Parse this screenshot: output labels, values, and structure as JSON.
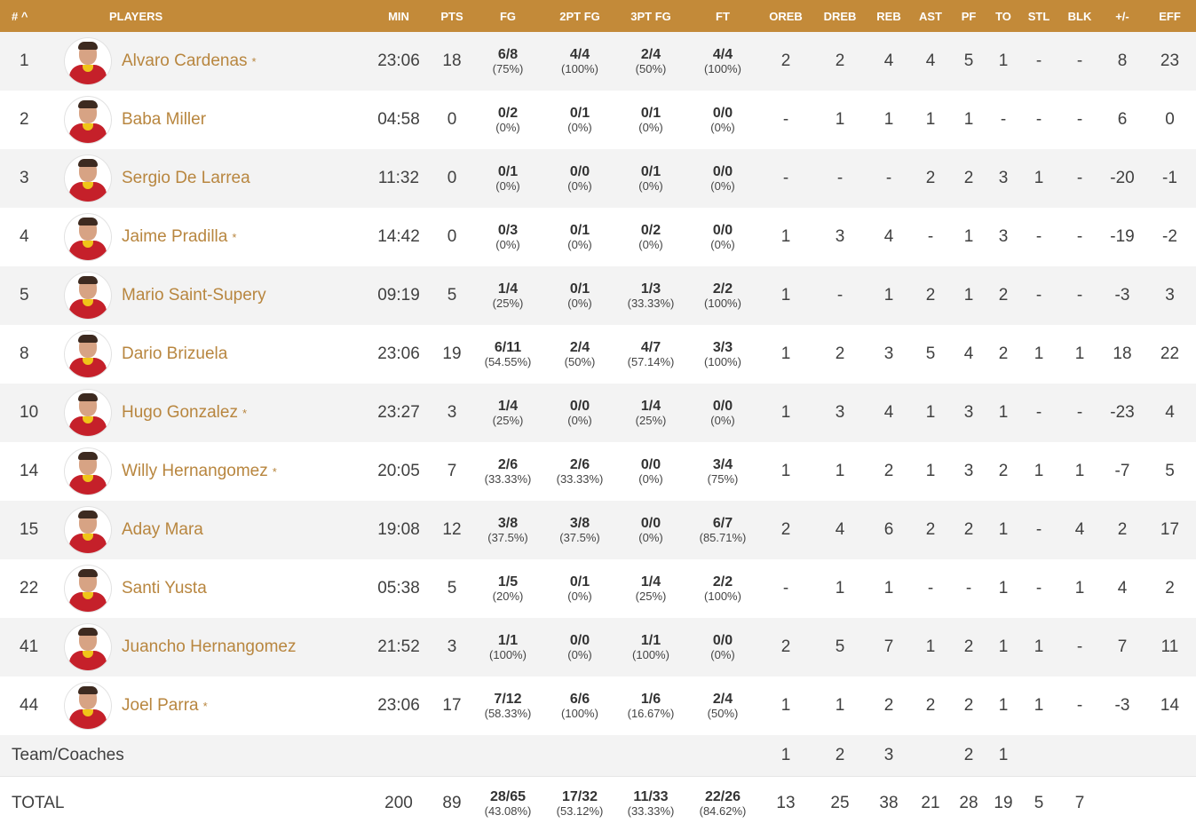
{
  "header": {
    "num": "# ^",
    "players": "PLAYERS",
    "min": "MIN",
    "pts": "PTS",
    "fg": "FG",
    "fg2": "2PT FG",
    "fg3": "3PT FG",
    "ft": "FT",
    "oreb": "OREB",
    "dreb": "DREB",
    "reb": "REB",
    "ast": "AST",
    "pf": "PF",
    "to": "TO",
    "stl": "STL",
    "blk": "BLK",
    "pm": "+/-",
    "eff": "EFF"
  },
  "players": [
    {
      "num": "1",
      "name": "Alvaro Cardenas",
      "starter": "*",
      "min": "23:06",
      "pts": "18",
      "fg": "6/8",
      "fg_pct": "(75%)",
      "fg2": "4/4",
      "fg2_pct": "(100%)",
      "fg3": "2/4",
      "fg3_pct": "(50%)",
      "ft": "4/4",
      "ft_pct": "(100%)",
      "oreb": "2",
      "dreb": "2",
      "reb": "4",
      "ast": "4",
      "pf": "5",
      "to": "1",
      "stl": "-",
      "blk": "-",
      "pm": "8",
      "eff": "23"
    },
    {
      "num": "2",
      "name": "Baba Miller",
      "starter": "",
      "min": "04:58",
      "pts": "0",
      "fg": "0/2",
      "fg_pct": "(0%)",
      "fg2": "0/1",
      "fg2_pct": "(0%)",
      "fg3": "0/1",
      "fg3_pct": "(0%)",
      "ft": "0/0",
      "ft_pct": "(0%)",
      "oreb": "-",
      "dreb": "1",
      "reb": "1",
      "ast": "1",
      "pf": "1",
      "to": "-",
      "stl": "-",
      "blk": "-",
      "pm": "6",
      "eff": "0"
    },
    {
      "num": "3",
      "name": "Sergio De Larrea",
      "starter": "",
      "min": "11:32",
      "pts": "0",
      "fg": "0/1",
      "fg_pct": "(0%)",
      "fg2": "0/0",
      "fg2_pct": "(0%)",
      "fg3": "0/1",
      "fg3_pct": "(0%)",
      "ft": "0/0",
      "ft_pct": "(0%)",
      "oreb": "-",
      "dreb": "-",
      "reb": "-",
      "ast": "2",
      "pf": "2",
      "to": "3",
      "stl": "1",
      "blk": "-",
      "pm": "-20",
      "eff": "-1"
    },
    {
      "num": "4",
      "name": "Jaime Pradilla",
      "starter": "*",
      "min": "14:42",
      "pts": "0",
      "fg": "0/3",
      "fg_pct": "(0%)",
      "fg2": "0/1",
      "fg2_pct": "(0%)",
      "fg3": "0/2",
      "fg3_pct": "(0%)",
      "ft": "0/0",
      "ft_pct": "(0%)",
      "oreb": "1",
      "dreb": "3",
      "reb": "4",
      "ast": "-",
      "pf": "1",
      "to": "3",
      "stl": "-",
      "blk": "-",
      "pm": "-19",
      "eff": "-2"
    },
    {
      "num": "5",
      "name": "Mario Saint-Supery",
      "starter": "",
      "min": "09:19",
      "pts": "5",
      "fg": "1/4",
      "fg_pct": "(25%)",
      "fg2": "0/1",
      "fg2_pct": "(0%)",
      "fg3": "1/3",
      "fg3_pct": "(33.33%)",
      "ft": "2/2",
      "ft_pct": "(100%)",
      "oreb": "1",
      "dreb": "-",
      "reb": "1",
      "ast": "2",
      "pf": "1",
      "to": "2",
      "stl": "-",
      "blk": "-",
      "pm": "-3",
      "eff": "3"
    },
    {
      "num": "8",
      "name": "Dario Brizuela",
      "starter": "",
      "min": "23:06",
      "pts": "19",
      "fg": "6/11",
      "fg_pct": "(54.55%)",
      "fg2": "2/4",
      "fg2_pct": "(50%)",
      "fg3": "4/7",
      "fg3_pct": "(57.14%)",
      "ft": "3/3",
      "ft_pct": "(100%)",
      "oreb": "1",
      "dreb": "2",
      "reb": "3",
      "ast": "5",
      "pf": "4",
      "to": "2",
      "stl": "1",
      "blk": "1",
      "pm": "18",
      "eff": "22"
    },
    {
      "num": "10",
      "name": "Hugo Gonzalez",
      "starter": "*",
      "min": "23:27",
      "pts": "3",
      "fg": "1/4",
      "fg_pct": "(25%)",
      "fg2": "0/0",
      "fg2_pct": "(0%)",
      "fg3": "1/4",
      "fg3_pct": "(25%)",
      "ft": "0/0",
      "ft_pct": "(0%)",
      "oreb": "1",
      "dreb": "3",
      "reb": "4",
      "ast": "1",
      "pf": "3",
      "to": "1",
      "stl": "-",
      "blk": "-",
      "pm": "-23",
      "eff": "4"
    },
    {
      "num": "14",
      "name": "Willy Hernangomez",
      "starter": "*",
      "min": "20:05",
      "pts": "7",
      "fg": "2/6",
      "fg_pct": "(33.33%)",
      "fg2": "2/6",
      "fg2_pct": "(33.33%)",
      "fg3": "0/0",
      "fg3_pct": "(0%)",
      "ft": "3/4",
      "ft_pct": "(75%)",
      "oreb": "1",
      "dreb": "1",
      "reb": "2",
      "ast": "1",
      "pf": "3",
      "to": "2",
      "stl": "1",
      "blk": "1",
      "pm": "-7",
      "eff": "5"
    },
    {
      "num": "15",
      "name": "Aday Mara",
      "starter": "",
      "min": "19:08",
      "pts": "12",
      "fg": "3/8",
      "fg_pct": "(37.5%)",
      "fg2": "3/8",
      "fg2_pct": "(37.5%)",
      "fg3": "0/0",
      "fg3_pct": "(0%)",
      "ft": "6/7",
      "ft_pct": "(85.71%)",
      "oreb": "2",
      "dreb": "4",
      "reb": "6",
      "ast": "2",
      "pf": "2",
      "to": "1",
      "stl": "-",
      "blk": "4",
      "pm": "2",
      "eff": "17"
    },
    {
      "num": "22",
      "name": "Santi Yusta",
      "starter": "",
      "min": "05:38",
      "pts": "5",
      "fg": "1/5",
      "fg_pct": "(20%)",
      "fg2": "0/1",
      "fg2_pct": "(0%)",
      "fg3": "1/4",
      "fg3_pct": "(25%)",
      "ft": "2/2",
      "ft_pct": "(100%)",
      "oreb": "-",
      "dreb": "1",
      "reb": "1",
      "ast": "-",
      "pf": "-",
      "to": "1",
      "stl": "-",
      "blk": "1",
      "pm": "4",
      "eff": "2"
    },
    {
      "num": "41",
      "name": "Juancho Hernangomez",
      "starter": "",
      "min": "21:52",
      "pts": "3",
      "fg": "1/1",
      "fg_pct": "(100%)",
      "fg2": "0/0",
      "fg2_pct": "(0%)",
      "fg3": "1/1",
      "fg3_pct": "(100%)",
      "ft": "0/0",
      "ft_pct": "(0%)",
      "oreb": "2",
      "dreb": "5",
      "reb": "7",
      "ast": "1",
      "pf": "2",
      "to": "1",
      "stl": "1",
      "blk": "-",
      "pm": "7",
      "eff": "11"
    },
    {
      "num": "44",
      "name": "Joel Parra",
      "starter": "*",
      "min": "23:06",
      "pts": "17",
      "fg": "7/12",
      "fg_pct": "(58.33%)",
      "fg2": "6/6",
      "fg2_pct": "(100%)",
      "fg3": "1/6",
      "fg3_pct": "(16.67%)",
      "ft": "2/4",
      "ft_pct": "(50%)",
      "oreb": "1",
      "dreb": "1",
      "reb": "2",
      "ast": "2",
      "pf": "2",
      "to": "1",
      "stl": "1",
      "blk": "-",
      "pm": "-3",
      "eff": "14"
    }
  ],
  "team": {
    "label": "Team/Coaches",
    "oreb": "1",
    "dreb": "2",
    "reb": "3",
    "pf": "2",
    "to": "1"
  },
  "total": {
    "label": "TOTAL",
    "min": "200",
    "pts": "89",
    "fg": "28/65",
    "fg_pct": "(43.08%)",
    "fg2": "17/32",
    "fg2_pct": "(53.12%)",
    "fg3": "11/33",
    "fg3_pct": "(33.33%)",
    "ft": "22/26",
    "ft_pct": "(84.62%)",
    "oreb": "13",
    "dreb": "25",
    "reb": "38",
    "ast": "21",
    "pf": "28",
    "to": "19",
    "stl": "5",
    "blk": "7"
  },
  "colors": {
    "header_bg": "#c38a39",
    "name_color": "#b8863f",
    "row_alt": "#f3f3f3",
    "jersey": "#c5202a"
  },
  "icons": {
    "avatar": "player-photo-icon",
    "sort": "sort-ascending-icon"
  }
}
